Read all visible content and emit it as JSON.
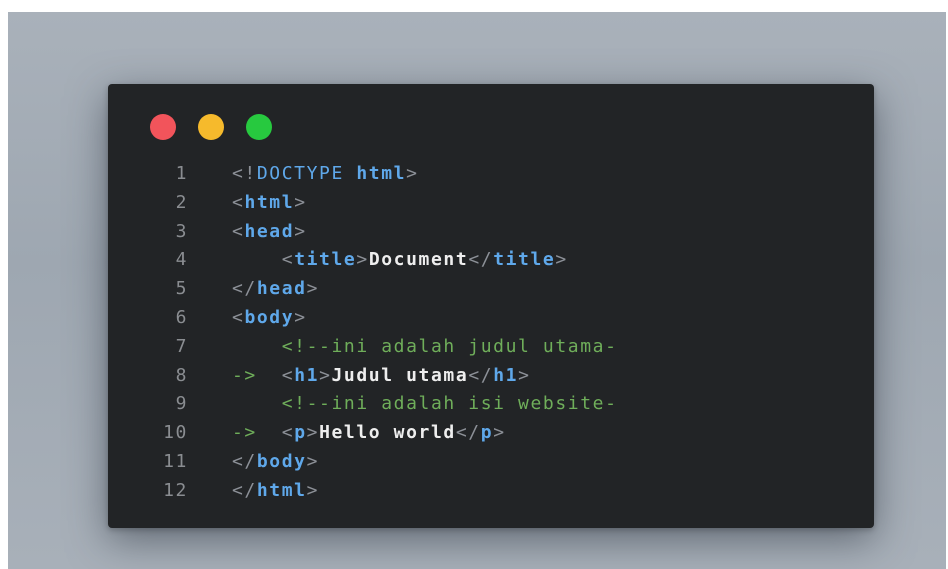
{
  "editor": {
    "traffic_lights": {
      "close_color": "#f2545b",
      "minimize_color": "#f6ba2c",
      "maximize_color": "#27c93f"
    },
    "colors": {
      "background": "#222426",
      "tag": "#5fa8ea",
      "punctuation": "#8c9097",
      "comment": "#6fae5a",
      "text": "#eeeeee",
      "line_number": "#8a8d91"
    },
    "lines": [
      {
        "number": "1",
        "tokens": [
          {
            "type": "punct",
            "text": "<!"
          },
          {
            "type": "doctype",
            "text": "DOCTYPE "
          },
          {
            "type": "tag",
            "text": "html"
          },
          {
            "type": "punct",
            "text": ">"
          }
        ]
      },
      {
        "number": "2",
        "tokens": [
          {
            "type": "punct",
            "text": "<"
          },
          {
            "type": "tag",
            "text": "html"
          },
          {
            "type": "punct",
            "text": ">"
          }
        ]
      },
      {
        "number": "3",
        "tokens": [
          {
            "type": "punct",
            "text": "<"
          },
          {
            "type": "tag",
            "text": "head"
          },
          {
            "type": "punct",
            "text": ">"
          }
        ]
      },
      {
        "number": "4",
        "tokens": [
          {
            "type": "plain",
            "text": "    "
          },
          {
            "type": "punct",
            "text": "<"
          },
          {
            "type": "tag",
            "text": "title"
          },
          {
            "type": "punct",
            "text": ">"
          },
          {
            "type": "text",
            "text": "Document"
          },
          {
            "type": "punct",
            "text": "</"
          },
          {
            "type": "tag",
            "text": "title"
          },
          {
            "type": "punct",
            "text": ">"
          }
        ]
      },
      {
        "number": "5",
        "tokens": [
          {
            "type": "punct",
            "text": "</"
          },
          {
            "type": "tag",
            "text": "head"
          },
          {
            "type": "punct",
            "text": ">"
          }
        ]
      },
      {
        "number": "6",
        "tokens": [
          {
            "type": "punct",
            "text": "<"
          },
          {
            "type": "tag",
            "text": "body"
          },
          {
            "type": "punct",
            "text": ">"
          }
        ]
      },
      {
        "number": "7",
        "tokens": [
          {
            "type": "plain",
            "text": "    "
          },
          {
            "type": "comment",
            "text": "<!--ini adalah judul utama-"
          }
        ]
      },
      {
        "number": "8",
        "tokens": [
          {
            "type": "comment",
            "text": "->"
          },
          {
            "type": "plain",
            "text": "  "
          },
          {
            "type": "punct",
            "text": "<"
          },
          {
            "type": "tag",
            "text": "h1"
          },
          {
            "type": "punct",
            "text": ">"
          },
          {
            "type": "text",
            "text": "Judul utama"
          },
          {
            "type": "punct",
            "text": "</"
          },
          {
            "type": "tag",
            "text": "h1"
          },
          {
            "type": "punct",
            "text": ">"
          }
        ]
      },
      {
        "number": "9",
        "tokens": [
          {
            "type": "plain",
            "text": "    "
          },
          {
            "type": "comment",
            "text": "<!--ini adalah isi website-"
          }
        ]
      },
      {
        "number": "10",
        "tokens": [
          {
            "type": "comment",
            "text": "->"
          },
          {
            "type": "plain",
            "text": "  "
          },
          {
            "type": "punct",
            "text": "<"
          },
          {
            "type": "tag",
            "text": "p"
          },
          {
            "type": "punct",
            "text": ">"
          },
          {
            "type": "text",
            "text": "Hello world"
          },
          {
            "type": "punct",
            "text": "</"
          },
          {
            "type": "tag",
            "text": "p"
          },
          {
            "type": "punct",
            "text": ">"
          }
        ]
      },
      {
        "number": "11",
        "tokens": [
          {
            "type": "punct",
            "text": "</"
          },
          {
            "type": "tag",
            "text": "body"
          },
          {
            "type": "punct",
            "text": ">"
          }
        ]
      },
      {
        "number": "12",
        "tokens": [
          {
            "type": "punct",
            "text": "</"
          },
          {
            "type": "tag",
            "text": "html"
          },
          {
            "type": "punct",
            "text": ">"
          }
        ]
      }
    ]
  }
}
